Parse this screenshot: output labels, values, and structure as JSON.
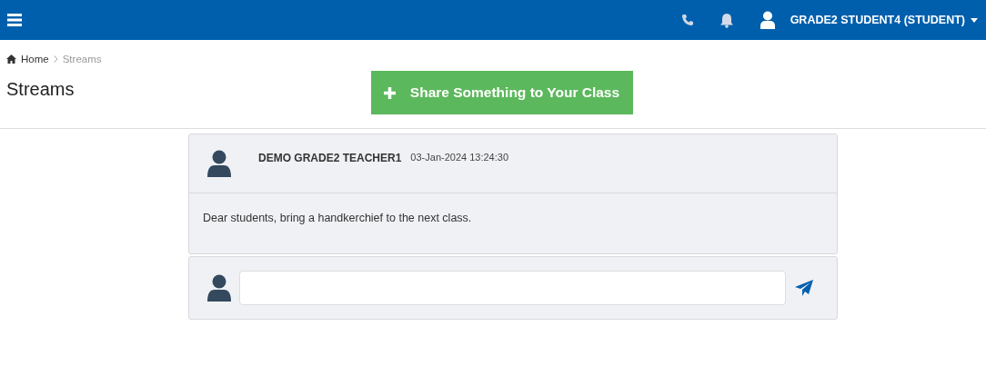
{
  "top_bar": {
    "user": "GRADE2 STUDENT4 (STUDENT)"
  },
  "breadcrumb": [
    {
      "label": "Home",
      "kind": "link"
    },
    {
      "label": "Streams",
      "kind": "current"
    }
  ],
  "page_title": "Streams",
  "share_button": "Share Something to Your Class",
  "posts": [
    {
      "author": "DEMO GRADE2 TEACHER1",
      "time": "03-Jan-2024 13:24:30",
      "message": "Dear students, bring a handkerchief to the next class."
    }
  ]
}
